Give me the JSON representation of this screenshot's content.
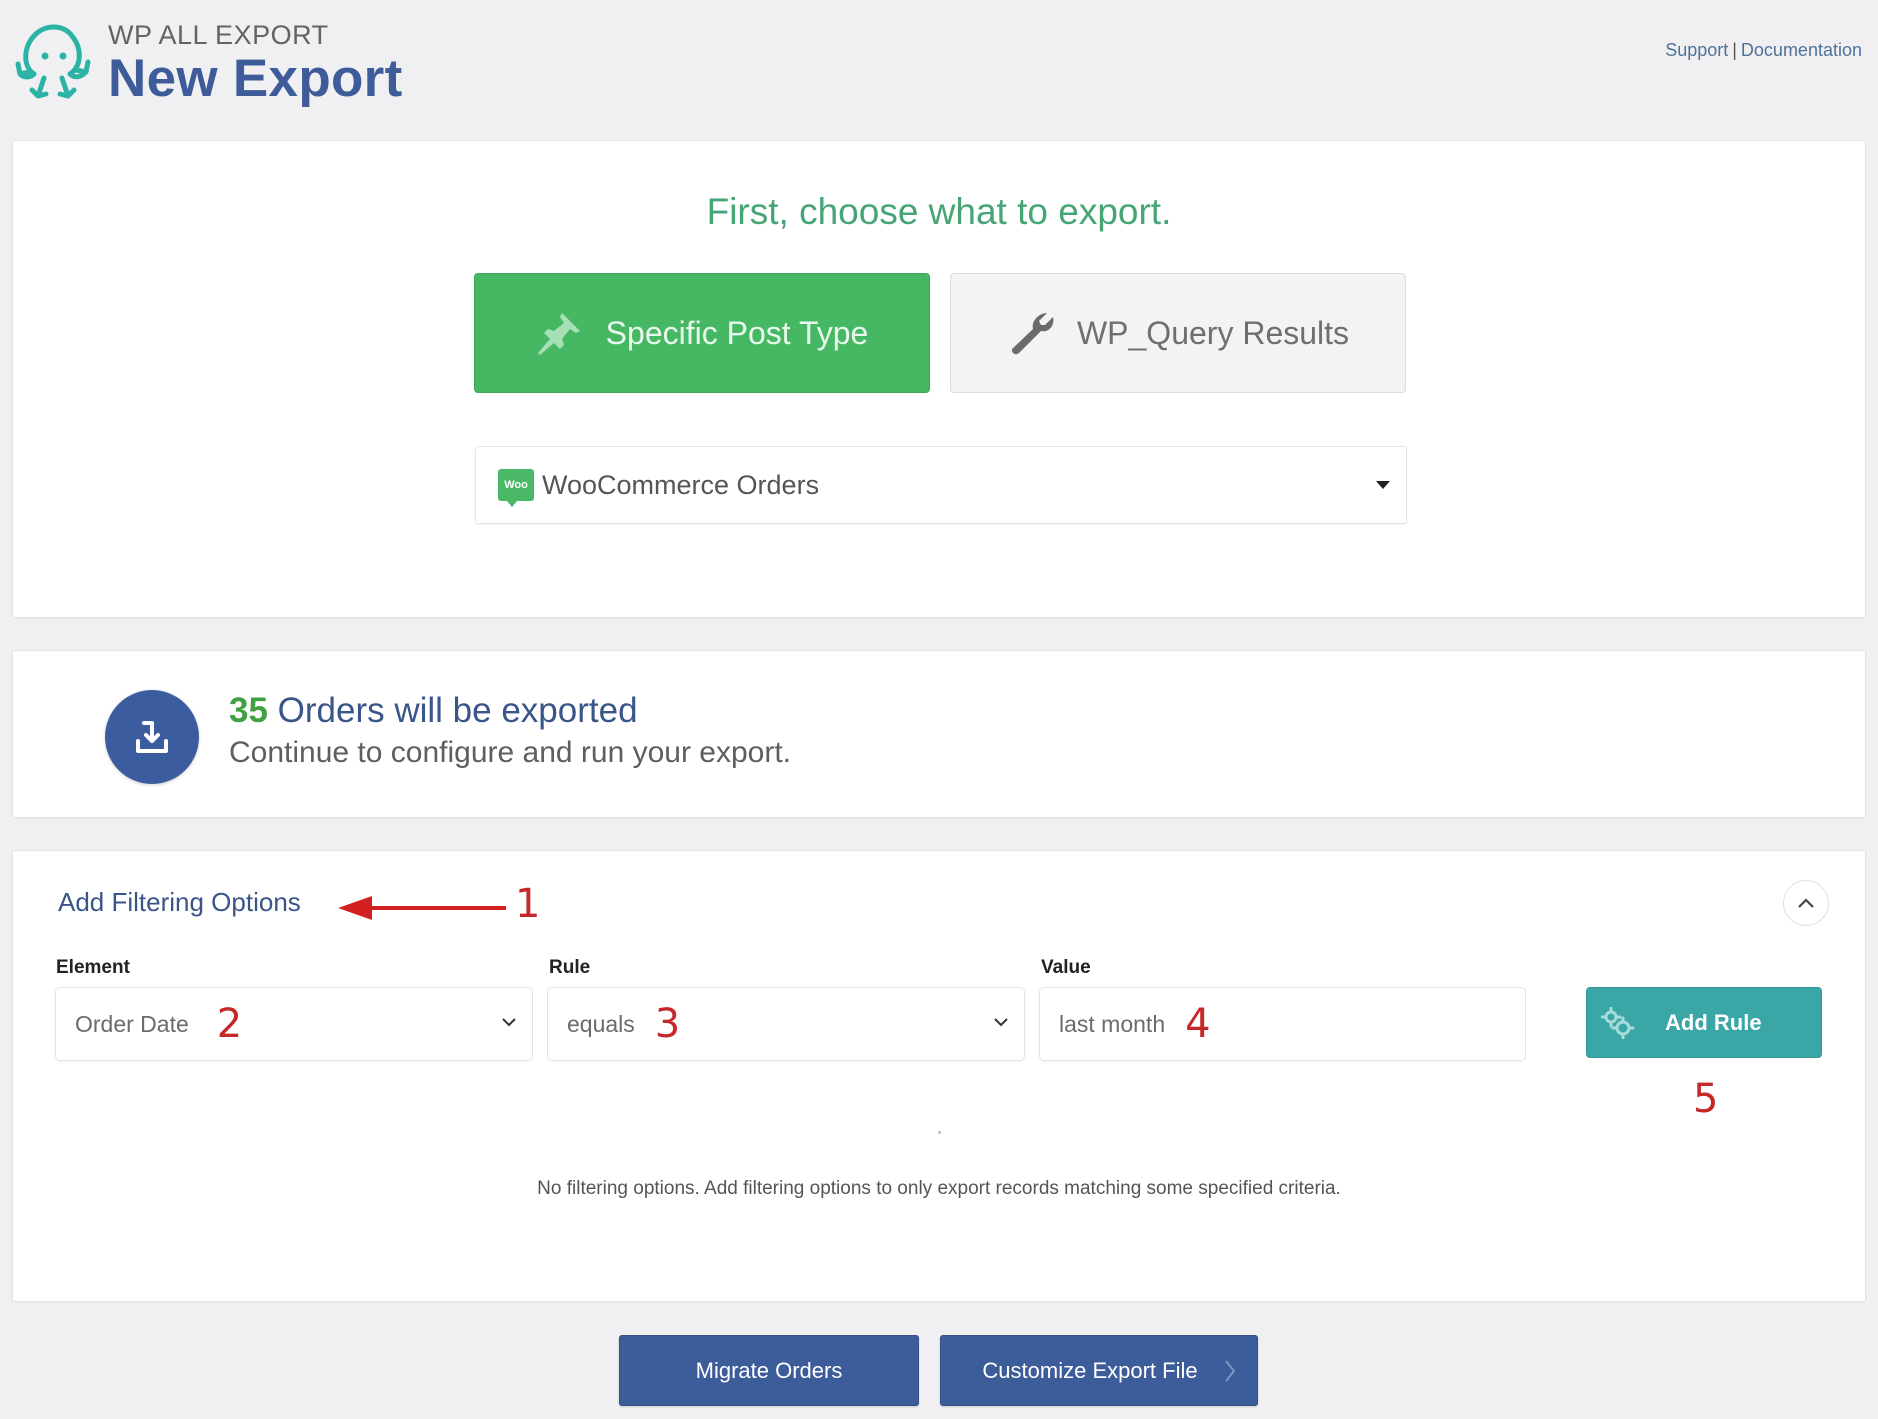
{
  "header": {
    "brand": "WP ALL EXPORT",
    "title": "New Export",
    "links": {
      "support": "Support",
      "separator": "|",
      "documentation": "Documentation"
    }
  },
  "choose": {
    "title": "First, choose what to export.",
    "options": [
      {
        "label": "Specific Post Type",
        "icon": "pin-icon",
        "selected": true
      },
      {
        "label": "WP_Query Results",
        "icon": "wrench-icon",
        "selected": false
      }
    ],
    "post_type_select": {
      "badge": "Woo",
      "value": "WooCommerce Orders"
    }
  },
  "summary": {
    "count": "35",
    "count_suffix": " Orders will be exported",
    "subtitle": "Continue to configure and run your export."
  },
  "filters": {
    "title": "Add Filtering Options",
    "element_label": "Element",
    "element_value": "Order Date",
    "rule_label": "Rule",
    "rule_value": "equals",
    "value_label": "Value",
    "value_value": "last month",
    "add_rule_label": "Add Rule",
    "empty_message": "No filtering options. Add filtering options to only export records matching some specified criteria."
  },
  "annotations": [
    "1",
    "2",
    "3",
    "4",
    "5"
  ],
  "footer": {
    "migrate_label": "Migrate Orders",
    "customize_label": "Customize Export File"
  },
  "colors": {
    "accent_green": "#46b864",
    "brand_blue": "#3d5c9a",
    "teal": "#3aa6a5",
    "annotation_red": "#c62828"
  }
}
